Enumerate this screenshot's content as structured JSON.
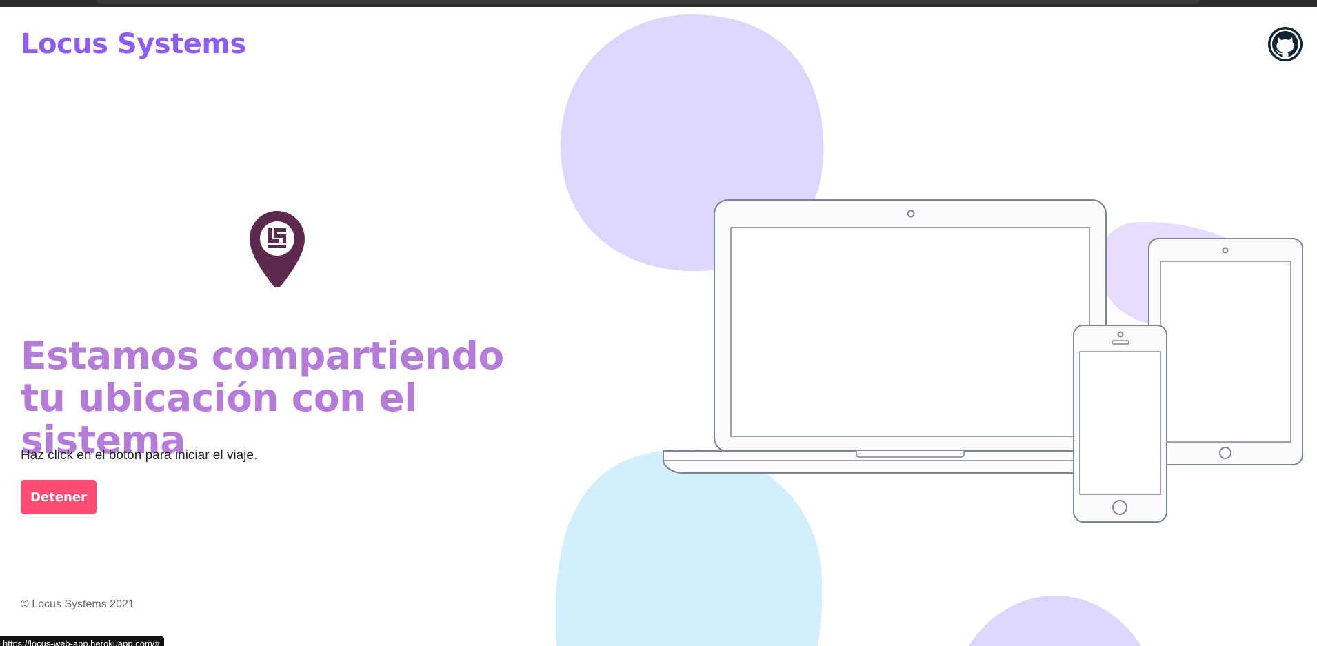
{
  "header": {
    "brand": "Locus Systems"
  },
  "hero": {
    "title": "Estamos compartiendo tu ubicación con el sistema",
    "hint": "Haz click en el botón para iniciar el viaje.",
    "button_label": "Detener"
  },
  "footer": {
    "copyright": "© Locus Systems 2021"
  },
  "status_bar": {
    "url": "https://locus-web-app.herokuapp.com/#"
  },
  "icons": {
    "github": "github-icon",
    "pin": "location-pin-logo-icon"
  },
  "colors": {
    "brand": "#8b5cf6",
    "title": "#b57bd9",
    "button": "#ff4d72",
    "blob_purple": "#ddd6fe",
    "blob_blue": "#d3effd",
    "pin": "#5b2a4e"
  }
}
